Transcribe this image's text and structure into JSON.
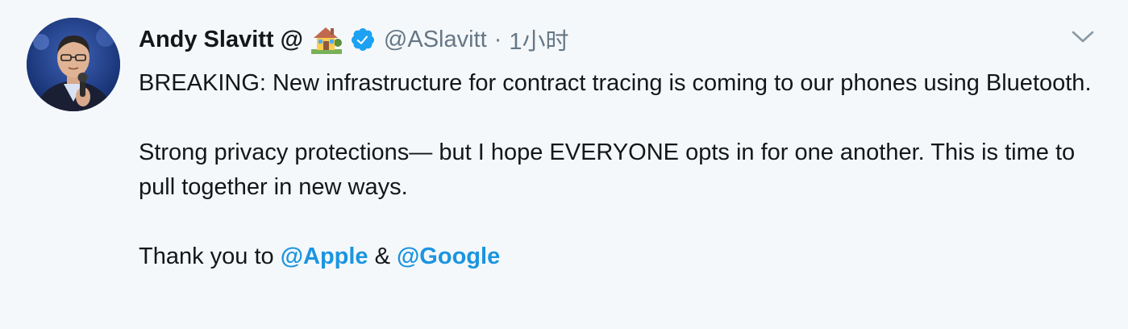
{
  "tweet": {
    "author": {
      "display_name": "Andy Slavitt @",
      "handle": "@ASlavitt",
      "verified": true,
      "emoji_icon": "house-with-garden-icon",
      "avatar_icon": "profile-photo"
    },
    "separator": "·",
    "timestamp": "1小时",
    "menu_icon": "chevron-down-icon",
    "paragraphs": [
      "BREAKING: New infrastructure for contract tracing is coming to our phones using Bluetooth.",
      "Strong privacy protections— but I hope EVERYONE opts in for one another. This is time to pull together in new ways."
    ],
    "thanks": {
      "prefix": "Thank you to ",
      "mention_1": "@Apple",
      "joiner": " & ",
      "mention_2": "@Google"
    }
  },
  "colors": {
    "background": "#f5f8fa",
    "text": "#14171a",
    "secondary_text": "#657786",
    "link": "#1b95e0",
    "verified": "#1da1f2"
  }
}
